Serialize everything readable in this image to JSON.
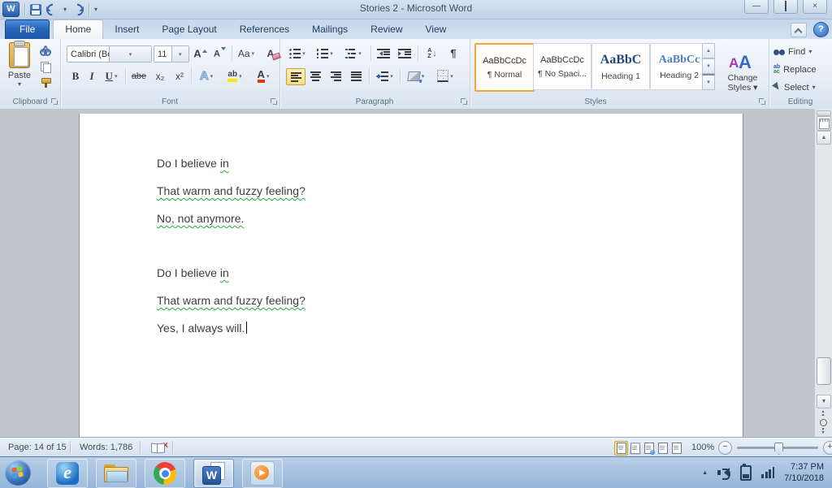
{
  "window": {
    "title": "Stories 2  -  Microsoft Word",
    "controls": {
      "minimize": "—",
      "close": "×",
      "help": "?"
    }
  },
  "tabs": [
    {
      "label": "File"
    },
    {
      "label": "Home"
    },
    {
      "label": "Insert"
    },
    {
      "label": "Page Layout"
    },
    {
      "label": "References"
    },
    {
      "label": "Mailings"
    },
    {
      "label": "Review"
    },
    {
      "label": "View"
    }
  ],
  "ribbon": {
    "clipboard": {
      "group_label": "Clipboard",
      "paste_label": "Paste"
    },
    "font": {
      "group_label": "Font",
      "font_name": "Calibri (Body)",
      "font_size": "11",
      "bold": "B",
      "italic": "I",
      "underline": "U",
      "strikethrough": "abe",
      "subscript": "x₂",
      "superscript": "x²",
      "change_case": "Aa",
      "grow_font": "A",
      "shrink_font": "A",
      "clear_formatting": "A",
      "text_effects": "A",
      "highlight": "ab",
      "font_color": "A"
    },
    "paragraph": {
      "group_label": "Paragraph",
      "sort_a": "A",
      "sort_z": "Z",
      "sort_arrow": "↓",
      "pilcrow": "¶"
    },
    "styles": {
      "group_label": "Styles",
      "items": [
        {
          "preview": "AaBbCcDc",
          "name": "¶ Normal"
        },
        {
          "preview": "AaBbCcDc",
          "name": "¶ No Spaci..."
        },
        {
          "preview": "AaBbC",
          "name": "Heading 1"
        },
        {
          "preview": "AaBbCc",
          "name": "Heading 2"
        }
      ],
      "change_styles_line1": "Change",
      "change_styles_line2": "Styles ▾"
    },
    "editing": {
      "group_label": "Editing",
      "find": "Find",
      "replace": "Replace",
      "select": "Select"
    }
  },
  "document": {
    "stanzas": [
      [
        {
          "segments": [
            {
              "t": "Do I believe ",
              "err": false
            },
            {
              "t": "in",
              "err": true
            }
          ]
        },
        {
          "segments": [
            {
              "t": "That warm and fuzzy feeling?",
              "err": true
            }
          ]
        },
        {
          "segments": [
            {
              "t": "No, not anymore.",
              "err": true
            }
          ]
        }
      ],
      [
        {
          "segments": [
            {
              "t": "Do I believe ",
              "err": false
            },
            {
              "t": "in",
              "err": true
            }
          ]
        },
        {
          "segments": [
            {
              "t": "That warm and fuzzy feeling?",
              "err": true
            }
          ]
        },
        {
          "segments": [
            {
              "t": "Yes, I always will.",
              "err": false
            }
          ],
          "cursor": true
        }
      ]
    ]
  },
  "status_bar": {
    "page": "Page: 14 of 15",
    "words": "Words: 1,786",
    "zoom_level": "100%",
    "zoom_out": "−",
    "zoom_in": "+"
  },
  "taskbar": {
    "clock_time": "7:37 PM",
    "clock_date": "7/10/2018",
    "word_letter": "W",
    "ie_letter": "e",
    "play": "▶"
  },
  "glyphs": {
    "dropdown": "▾",
    "scroll_up": "▲",
    "scroll_down": "▼",
    "tray_expand": "▲",
    "cs_a1": "A",
    "cs_a2": "A",
    "replace_ab": "ab",
    "replace_ac": "ac"
  },
  "colors": {
    "accent_orange": "#F0A63C",
    "squiggle_green": "#1FAE3F",
    "heading1_blue": "#1F497D",
    "heading2_blue": "#4F81BD",
    "file_tab_blue": "#2767BA"
  }
}
